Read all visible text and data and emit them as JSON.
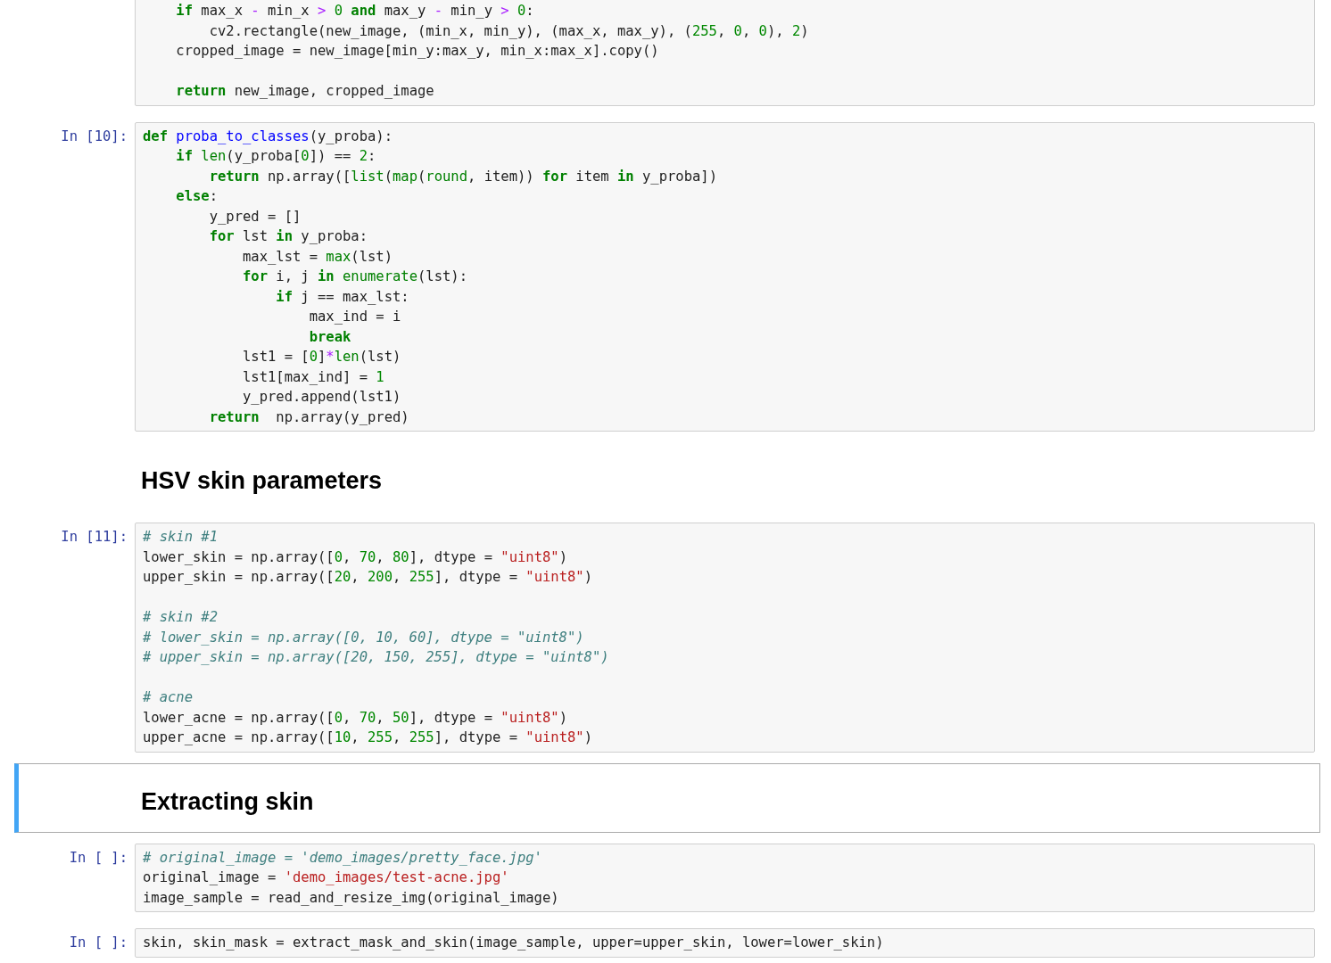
{
  "cells": [
    {
      "kind": "code",
      "selected": false,
      "blocks": [
        [
          [
            {
              "kind": "kw",
              "text": "    if"
            },
            " max_x ",
            {
              "kind": "op",
              "text": "-"
            },
            " min_x ",
            {
              "kind": "op",
              "text": ">"
            },
            {
              "kind": "num",
              "text": " 0"
            },
            {
              "kind": "kw",
              "text": " and"
            },
            " max_y ",
            {
              "kind": "op",
              "text": "-"
            },
            " min_y ",
            {
              "kind": "op",
              "text": ">"
            },
            {
              "kind": "num",
              "text": " 0"
            },
            ":"
          ],
          [
            "        cv2.rectangle(new_image, (min_x, min_y), (max_x, max_y), (",
            {
              "kind": "num",
              "text": "255"
            },
            ", ",
            {
              "kind": "num",
              "text": "0"
            },
            ", ",
            {
              "kind": "num",
              "text": "0"
            },
            "), ",
            {
              "kind": "num",
              "text": "2"
            },
            ")"
          ],
          [
            "    cropped_image = new_image[min_y:max_y, min_x:max_x].copy()"
          ]
        ],
        [
          [
            {
              "kind": "kw",
              "text": "    return"
            },
            " new_image, cropped_image"
          ]
        ]
      ]
    },
    {
      "kind": "code",
      "selected": false,
      "prompt": "In [10]:",
      "blocks": [
        [
          [
            {
              "kind": "kw",
              "text": "def"
            },
            {
              "kind": "def",
              "text": " proba_to_classes"
            },
            "(y_proba):"
          ],
          [
            {
              "kind": "kw",
              "text": "    if"
            },
            {
              "kind": "bi",
              "text": " len"
            },
            "(y_proba[",
            {
              "kind": "num",
              "text": "0"
            },
            "]) == ",
            {
              "kind": "num",
              "text": "2"
            },
            ":"
          ],
          [
            {
              "kind": "kw",
              "text": "        return"
            },
            " np.array([",
            {
              "kind": "bi",
              "text": "list"
            },
            "(",
            {
              "kind": "bi",
              "text": "map"
            },
            "(",
            {
              "kind": "bi",
              "text": "round"
            },
            ", item)) ",
            {
              "kind": "kw",
              "text": "for"
            },
            " item ",
            {
              "kind": "kw",
              "text": "in"
            },
            " y_proba])"
          ],
          [
            {
              "kind": "kw",
              "text": "    else"
            },
            ":"
          ],
          [
            "        y_pred = []"
          ],
          [
            {
              "kind": "kw",
              "text": "        for"
            },
            " lst ",
            {
              "kind": "kw",
              "text": "in"
            },
            " y_proba:"
          ],
          [
            "            max_lst = ",
            {
              "kind": "bi",
              "text": "max"
            },
            "(lst)"
          ],
          [
            {
              "kind": "kw",
              "text": "            for"
            },
            " i, j ",
            {
              "kind": "kw",
              "text": "in"
            },
            {
              "kind": "bi",
              "text": " enumerate"
            },
            "(lst):"
          ],
          [
            {
              "kind": "kw",
              "text": "                if"
            },
            " j == max_lst:"
          ],
          [
            "                    max_ind = i"
          ],
          [
            {
              "kind": "kw",
              "text": "                    break"
            }
          ],
          [
            "            lst1 = [",
            {
              "kind": "num",
              "text": "0"
            },
            "]",
            {
              "kind": "op",
              "text": "*"
            },
            {
              "kind": "bi",
              "text": "len"
            },
            "(lst)"
          ],
          [
            "            lst1[max_ind] = ",
            {
              "kind": "num",
              "text": "1"
            }
          ],
          [
            "            y_pred.append(lst1)"
          ],
          [
            {
              "kind": "kw",
              "text": "        return"
            },
            "  np.array(y_pred)"
          ]
        ]
      ]
    },
    {
      "kind": "markdown",
      "selected": false,
      "heading": "HSV skin parameters"
    },
    {
      "kind": "code",
      "selected": false,
      "prompt": "In [11]:",
      "blocks": [
        [
          [
            {
              "kind": "com",
              "text": "# skin #1"
            }
          ],
          [
            "lower_skin = np.array([",
            {
              "kind": "num",
              "text": "0"
            },
            ", ",
            {
              "kind": "num",
              "text": "70"
            },
            ", ",
            {
              "kind": "num",
              "text": "80"
            },
            "], dtype = ",
            {
              "kind": "str",
              "text": "\"uint8\""
            },
            ")"
          ],
          [
            "upper_skin = np.array([",
            {
              "kind": "num",
              "text": "20"
            },
            ", ",
            {
              "kind": "num",
              "text": "200"
            },
            ", ",
            {
              "kind": "num",
              "text": "255"
            },
            "], dtype = ",
            {
              "kind": "str",
              "text": "\"uint8\""
            },
            ")"
          ]
        ],
        [
          [
            {
              "kind": "com",
              "text": "# skin #2"
            }
          ],
          [
            {
              "kind": "com",
              "text": "# lower_skin = np.array([0, 10, 60], dtype = \"uint8\")"
            }
          ],
          [
            {
              "kind": "com",
              "text": "# upper_skin = np.array([20, 150, 255], dtype = \"uint8\")"
            }
          ]
        ],
        [
          [
            {
              "kind": "com",
              "text": "# acne"
            }
          ],
          [
            "lower_acne = np.array([",
            {
              "kind": "num",
              "text": "0"
            },
            ", ",
            {
              "kind": "num",
              "text": "70"
            },
            ", ",
            {
              "kind": "num",
              "text": "50"
            },
            "], dtype = ",
            {
              "kind": "str",
              "text": "\"uint8\""
            },
            ")"
          ],
          [
            "upper_acne = np.array([",
            {
              "kind": "num",
              "text": "10"
            },
            ", ",
            {
              "kind": "num",
              "text": "255"
            },
            ", ",
            {
              "kind": "num",
              "text": "255"
            },
            "], dtype = ",
            {
              "kind": "str",
              "text": "\"uint8\""
            },
            ")"
          ]
        ]
      ]
    },
    {
      "kind": "markdown",
      "selected": true,
      "heading": "Extracting skin"
    },
    {
      "kind": "code",
      "selected": false,
      "prompt": "In [ ]:",
      "blocks": [
        [
          [
            {
              "kind": "com",
              "text": "# original_image = 'demo_images/pretty_face.jpg'"
            }
          ],
          [
            "original_image = ",
            {
              "kind": "str",
              "text": "'demo_images/test-acne.jpg'"
            }
          ],
          [
            "image_sample = read_and_resize_img(original_image)"
          ]
        ]
      ]
    },
    {
      "kind": "code",
      "selected": false,
      "prompt": "In [ ]:",
      "blocks": [
        [
          [
            "skin, skin_mask = extract_mask_and_skin(image_sample, upper=upper_skin, lower=lower_skin)"
          ]
        ]
      ]
    }
  ]
}
